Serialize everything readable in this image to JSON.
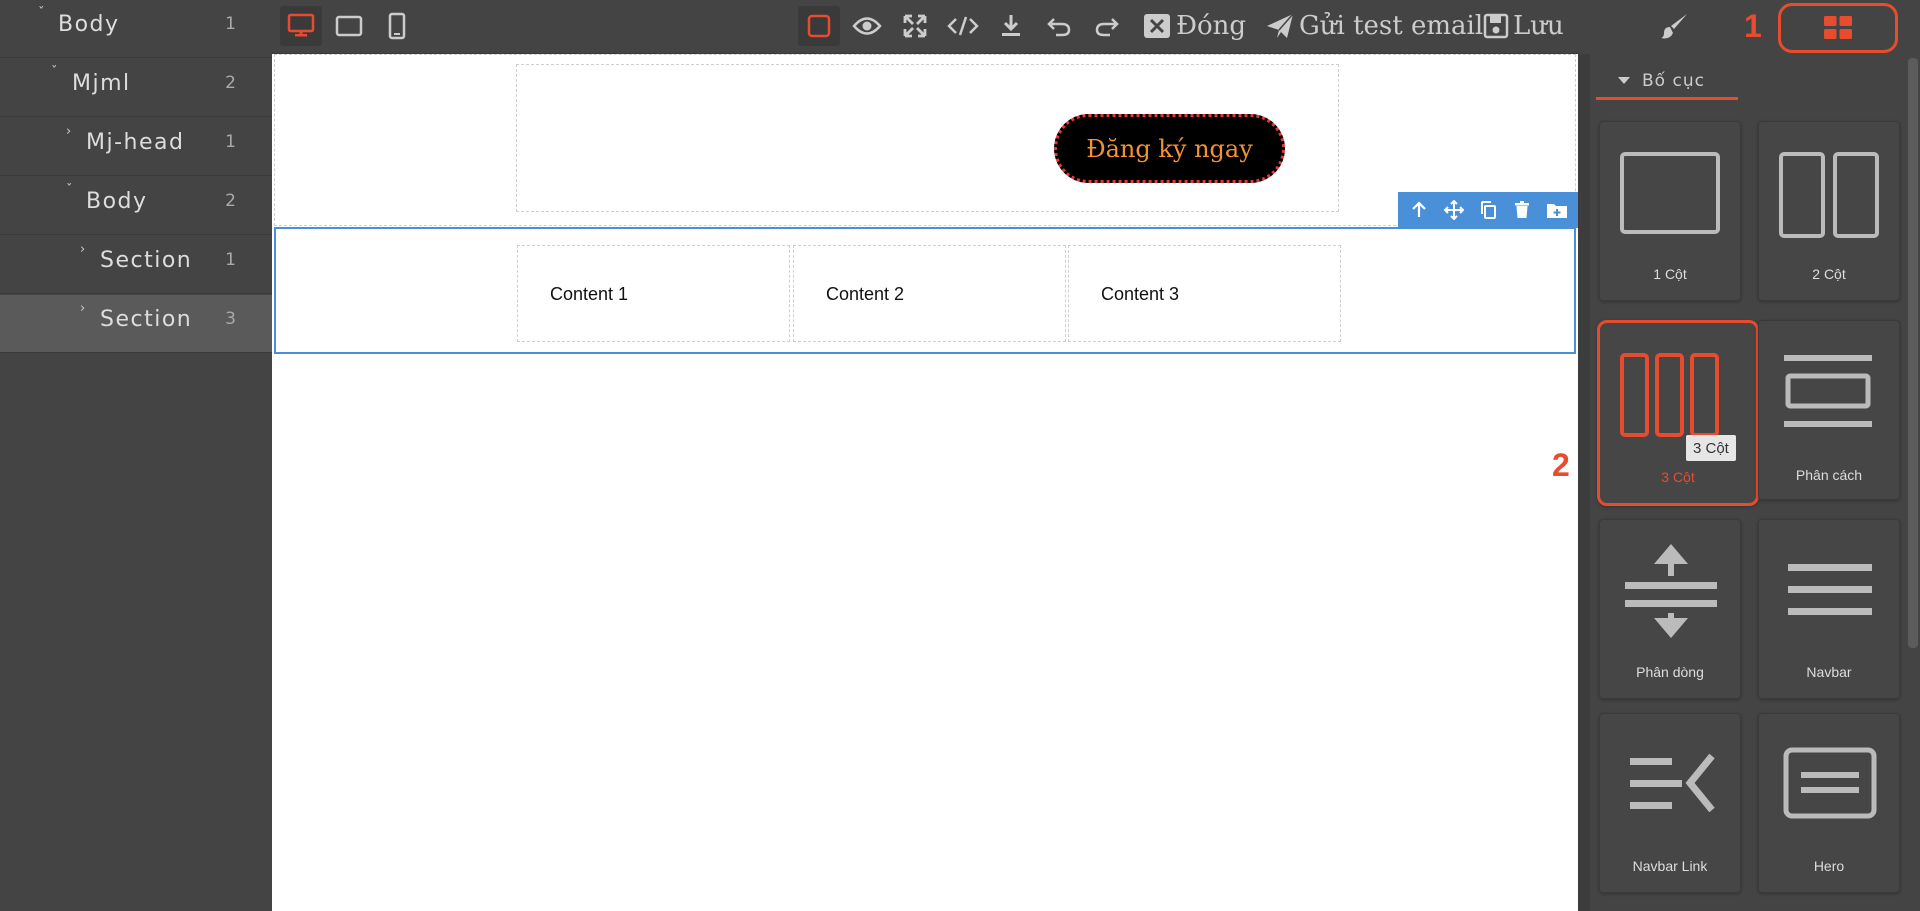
{
  "layers": [
    {
      "name": "Body",
      "count": "1"
    },
    {
      "name": "Mjml",
      "count": "2"
    },
    {
      "name": "Mj-head",
      "count": "1"
    },
    {
      "name": "Body",
      "count": "2"
    },
    {
      "name": "Section",
      "count": "1"
    },
    {
      "name": "Section",
      "count": "3",
      "active": true
    }
  ],
  "toolbar": {
    "close_label": "Đóng",
    "send_test_label": "Gửi test email",
    "save_label": "Lưu"
  },
  "canvas": {
    "cta_label": "Đăng ký ngay",
    "columns": [
      "Content 1",
      "Content 2",
      "Content 3"
    ]
  },
  "annotations": {
    "marker_1": "1",
    "marker_2": "2"
  },
  "panel": {
    "category": "Bố cục",
    "blocks": [
      "1 Cột",
      "2 Cột",
      "3 Cột",
      "Phân cách",
      "Phân dòng",
      "Navbar",
      "Navbar Link",
      "Hero"
    ],
    "tooltip": "3 Cột"
  },
  "colors": {
    "accent": "#e84c2e",
    "selection": "#4a90d9",
    "cta_text": "#f39234"
  }
}
